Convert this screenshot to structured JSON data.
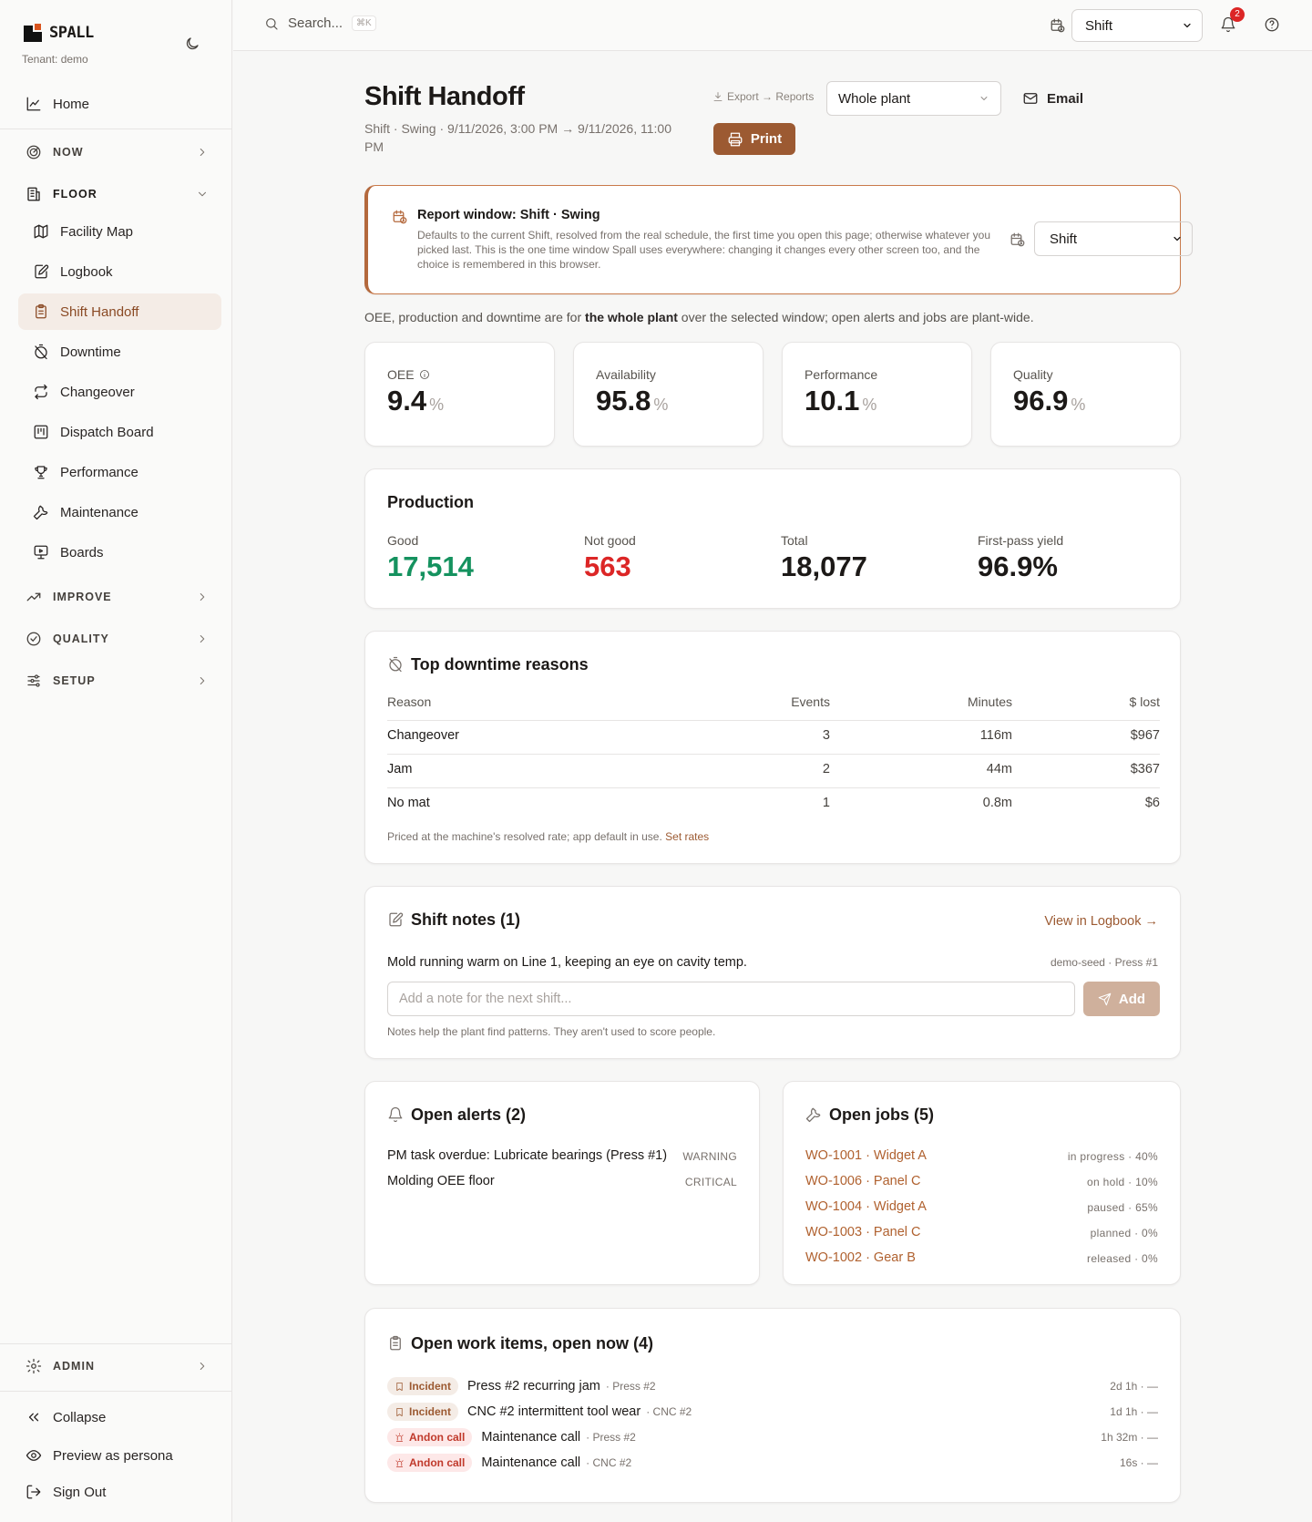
{
  "brand": {
    "name": "SPALL",
    "tenant": "Tenant: demo"
  },
  "sidebar": {
    "home": "Home",
    "groups": {
      "now": "NOW",
      "floor": "FLOOR",
      "improve": "IMPROVE",
      "quality": "QUALITY",
      "setup": "SETUP",
      "admin": "ADMIN"
    },
    "floor_items": [
      {
        "label": "Facility Map",
        "icon": "map-icon"
      },
      {
        "label": "Logbook",
        "icon": "notebook-pen-icon"
      },
      {
        "label": "Shift Handoff",
        "icon": "clipboard-icon",
        "active": true
      },
      {
        "label": "Downtime",
        "icon": "timer-off-icon"
      },
      {
        "label": "Changeover",
        "icon": "repeat-icon"
      },
      {
        "label": "Dispatch Board",
        "icon": "kanban-icon"
      },
      {
        "label": "Performance",
        "icon": "trophy-icon"
      },
      {
        "label": "Maintenance",
        "icon": "wrench-icon"
      },
      {
        "label": "Boards",
        "icon": "presentation-icon"
      }
    ],
    "footer": {
      "collapse": "Collapse",
      "preview": "Preview as persona",
      "signout": "Sign Out"
    }
  },
  "topbar": {
    "search_placeholder": "Search...",
    "search_kbd": "⌘K",
    "window_select": "Shift",
    "notification_count": "2"
  },
  "page": {
    "title": "Shift Handoff",
    "subtitle": "Shift · Swing · 9/11/2026, 3:00 PM → 9/11/2026, 11:00 PM",
    "export_link": "Export → Reports",
    "scope_select": "Whole plant",
    "email": "Email",
    "print": "Print"
  },
  "report_window": {
    "title": "Report window: Shift · Swing",
    "description": "Defaults to the current Shift, resolved from the real schedule, the first time you open this page; otherwise whatever you picked last. This is the one time window Spall uses everywhere: changing it changes every other screen too, and the choice is remembered in this browser.",
    "select": "Shift"
  },
  "scope_note": {
    "prefix": "OEE, production and downtime are for ",
    "bold": "the whole plant",
    "suffix": " over the selected window; open alerts and jobs are plant-wide."
  },
  "kpis": [
    {
      "label": "OEE",
      "value": "9.4",
      "unit": "%",
      "info": true
    },
    {
      "label": "Availability",
      "value": "95.8",
      "unit": "%"
    },
    {
      "label": "Performance",
      "value": "10.1",
      "unit": "%"
    },
    {
      "label": "Quality",
      "value": "96.9",
      "unit": "%"
    }
  ],
  "production": {
    "title": "Production",
    "cells": [
      {
        "label": "Good",
        "value": "17,514",
        "color": "#15925f"
      },
      {
        "label": "Not good",
        "value": "563",
        "color": "#dc2626"
      },
      {
        "label": "Total",
        "value": "18,077",
        "color": "#1c1917"
      },
      {
        "label": "First-pass yield",
        "value": "96.9%",
        "color": "#1c1917"
      }
    ]
  },
  "downtime": {
    "title": "Top downtime reasons",
    "columns": [
      "Reason",
      "Events",
      "Minutes",
      "$ lost"
    ],
    "rows": [
      [
        "Changeover",
        "3",
        "116m",
        "$967"
      ],
      [
        "Jam",
        "2",
        "44m",
        "$367"
      ],
      [
        "No mat",
        "1",
        "0.8m",
        "$6"
      ]
    ],
    "footnote": "Priced at the machine's resolved rate; app default in use.",
    "footnote_link": "Set rates"
  },
  "notes": {
    "title": "Shift notes (1)",
    "link": "View in Logbook →",
    "items": [
      {
        "text": "Mold running warm on Line 1, keeping an eye on cavity temp.",
        "meta": "demo-seed · Press #1"
      }
    ],
    "input_placeholder": "Add a note for the next shift...",
    "add": "Add",
    "footnote": "Notes help the plant find patterns. They aren't used to score people."
  },
  "alerts": {
    "title": "Open alerts (2)",
    "items": [
      {
        "text": "PM task overdue: Lubricate bearings (Press #1)",
        "severity": "WARNING"
      },
      {
        "text": "Molding OEE floor",
        "severity": "CRITICAL"
      }
    ]
  },
  "jobs": {
    "title": "Open jobs (5)",
    "items": [
      {
        "text": "WO-1001 · Widget A",
        "status": "in progress · 40%"
      },
      {
        "text": "WO-1006 · Panel C",
        "status": "on hold · 10%"
      },
      {
        "text": "WO-1004 · Widget A",
        "status": "paused · 65%"
      },
      {
        "text": "WO-1003 · Panel C",
        "status": "planned · 0%"
      },
      {
        "text": "WO-1002 · Gear B",
        "status": "released · 0%"
      }
    ]
  },
  "work_items": {
    "title": "Open work items, open now (4)",
    "items": [
      {
        "kind": "Incident",
        "title": "Press #2 recurring jam",
        "asset": "· Press #2",
        "age": "2d 1h · —"
      },
      {
        "kind": "Incident",
        "title": "CNC #2 intermittent tool wear",
        "asset": "· CNC #2",
        "age": "1d 1h · —"
      },
      {
        "kind": "Andon call",
        "title": "Maintenance call",
        "asset": "· Press #2",
        "age": "1h 32m · —"
      },
      {
        "kind": "Andon call",
        "title": "Maintenance call",
        "asset": "· CNC #2",
        "age": "16s · —"
      }
    ]
  },
  "colors": {
    "accent": "#9c5a32",
    "good": "#15925f",
    "bad": "#dc2626"
  }
}
